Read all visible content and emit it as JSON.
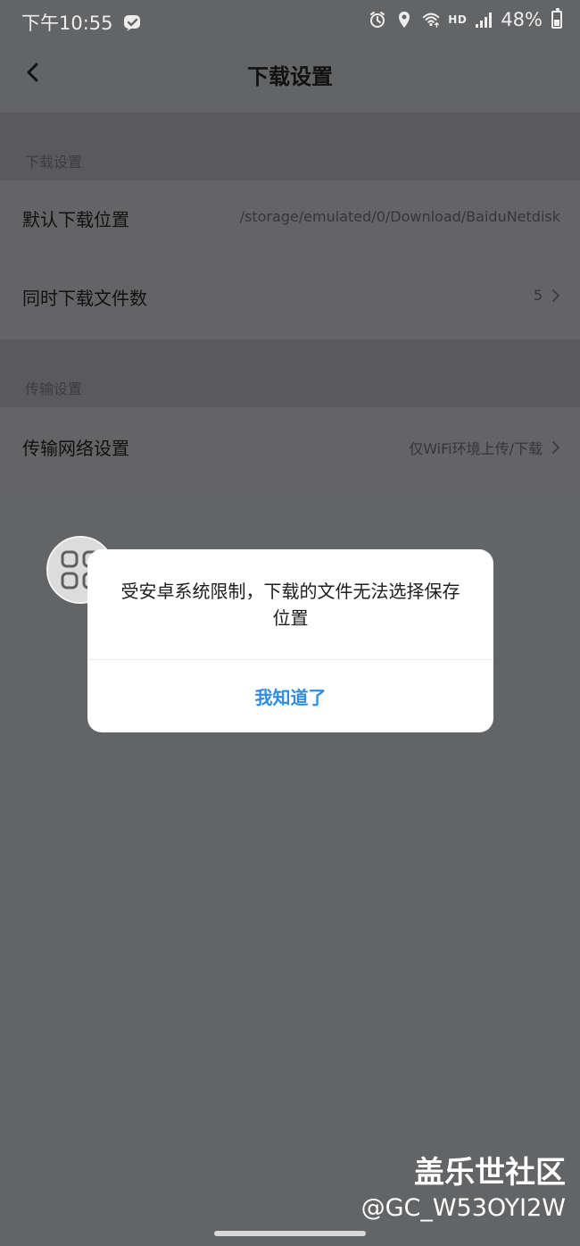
{
  "status_bar": {
    "time": "下午10:55",
    "network": "HD",
    "battery": "48%",
    "battery_level": 0.48,
    "icons": [
      "messages-icon",
      "alarm-icon",
      "location-icon",
      "wifi-icon",
      "signal-icon",
      "battery-icon"
    ]
  },
  "header": {
    "title": "下载设置",
    "back_icon": "chevron-left-icon"
  },
  "sections": {
    "download": {
      "title": "下载设置",
      "rows": [
        {
          "label": "默认下载位置",
          "value": "/storage/emulated/0/Download/BaiduNetdisk"
        },
        {
          "label": "同时下载文件数",
          "value": "5"
        }
      ]
    },
    "transfer": {
      "title": "传输设置",
      "rows": [
        {
          "label": "传输网络设置",
          "value": "仅WiFi环境上传/下载"
        }
      ]
    }
  },
  "floating_tool": {
    "icon": "grid-icon"
  },
  "dialog": {
    "message": "受安卓系统限制，下载的文件无法选择保存位置",
    "button": "我知道了",
    "accent_color": "#2f8dde"
  },
  "watermark": {
    "title": "盖乐世社区",
    "user": "@GC_W53OYI2W"
  },
  "theme": {
    "overlay_color": "#636466",
    "dialog_background": "#ffffff"
  }
}
